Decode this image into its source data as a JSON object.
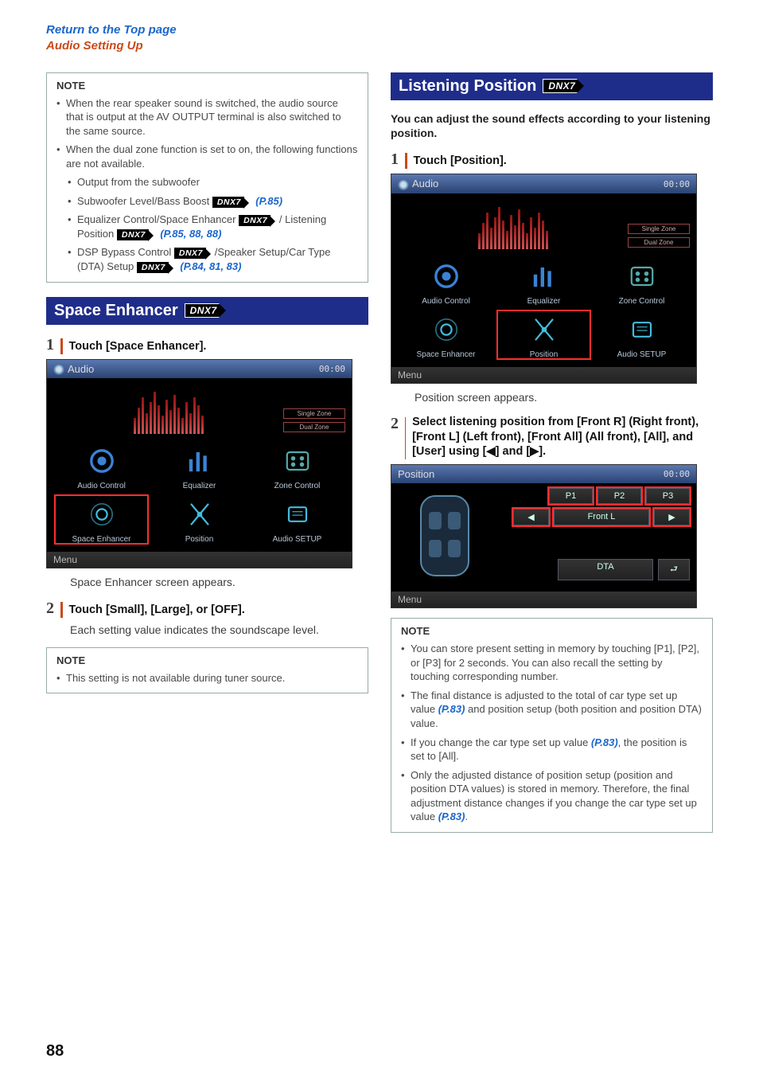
{
  "top": {
    "return": "Return to the Top page",
    "audio": "Audio Setting Up"
  },
  "badge": "DNX7",
  "pageNum": "88",
  "left": {
    "note1": {
      "title": "NOTE",
      "b1": "When the rear speaker sound is switched, the audio source that is output at the AV OUTPUT terminal is also switched to the same source.",
      "b2": "When the dual zone function is set to on, the following functions are not available.",
      "s1": "Output from the subwoofer",
      "s2a": "Subwoofer Level/Bass Boost ",
      "s2b": " (P.85)",
      "s3a": "Equalizer Control/Space Enhancer ",
      "s3b": "/ Listening Position ",
      "s3c": " (P.85, 88, 88)",
      "s4a": "DSP Bypass Control ",
      "s4b": "/Speaker Setup/Car Type (DTA) Setup ",
      "s4c": " (P.84, 81, 83)"
    },
    "heading": "Space Enhancer",
    "step1": {
      "num": "1",
      "text": "Touch [Space Enhancer]."
    },
    "caption1": "Space Enhancer screen appears.",
    "step2": {
      "num": "2",
      "text": "Touch [Small], [Large], or [OFF].",
      "body": "Each setting value indicates the soundscape level."
    },
    "note2": {
      "title": "NOTE",
      "b1": "This setting is not available during tuner source."
    }
  },
  "right": {
    "heading": "Listening Position",
    "intro": "You can adjust the sound effects according to your listening position.",
    "step1": {
      "num": "1",
      "text": "Touch [Position]."
    },
    "caption1": "Position screen appears.",
    "step2": {
      "num": "2",
      "text": "Select listening position from [Front R] (Right front), [Front L] (Left front), [Front All] (All front), [All], and [User] using [◀] and [▶]."
    },
    "note": {
      "title": "NOTE",
      "b1": "You can store present setting in memory by touching [P1], [P2], or [P3] for 2 seconds. You can also recall the setting by touching corresponding number.",
      "b2a": "The final distance is adjusted to the total of car type set up value ",
      "b2b": "(P.83)",
      "b2c": " and position setup (both position and position DTA) value.",
      "b3a": "If you change the car type set up value ",
      "b3b": "(P.83)",
      "b3c": ", the position is set to [All].",
      "b4a": "Only the adjusted distance of position setup (position and position DTA values) is stored in memory. Therefore, the final adjustment distance changes if you change the car type set up value ",
      "b4b": "(P.83)",
      "b4c": "."
    }
  },
  "shot": {
    "audio": "Audio",
    "clock": "00:00",
    "sb1": "Single Zone",
    "sb2": "Dual Zone",
    "tiles": {
      "ac": "Audio Control",
      "eq": "Equalizer",
      "zc": "Zone Control",
      "se": "Space Enhancer",
      "pos": "Position",
      "as": "Audio SETUP"
    },
    "menu": "Menu",
    "position": "Position",
    "p1": "P1",
    "p2": "P2",
    "p3": "P3",
    "left": "◀",
    "frontl": "Front L",
    "right": "▶",
    "dta": "DTA",
    "ret": "⮐"
  }
}
